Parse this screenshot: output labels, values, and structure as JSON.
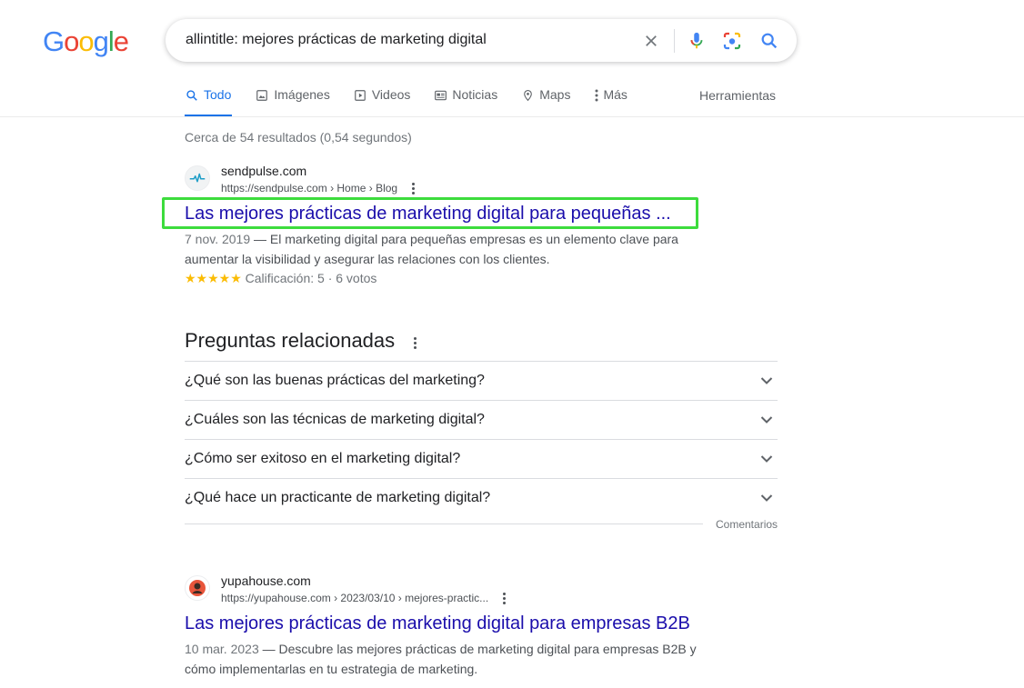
{
  "logo": {
    "letters": [
      "G",
      "o",
      "o",
      "g",
      "l",
      "e"
    ],
    "colors": [
      "#4285F4",
      "#EA4335",
      "#FBBC05",
      "#4285F4",
      "#34A853",
      "#EA4335"
    ]
  },
  "search": {
    "query": "allintitle: mejores prácticas de marketing digital",
    "icons": [
      "close-icon",
      "microphone-icon",
      "camera-lens-icon",
      "search-icon"
    ]
  },
  "tabs": [
    {
      "label": "Todo",
      "icon": "search-icon",
      "active": true
    },
    {
      "label": "Imágenes",
      "icon": "image-icon"
    },
    {
      "label": "Videos",
      "icon": "play-icon"
    },
    {
      "label": "Noticias",
      "icon": "news-icon"
    },
    {
      "label": "Maps",
      "icon": "map-pin-icon"
    },
    {
      "label": "Más",
      "icon": "vertical-dots-icon"
    }
  ],
  "tools_label": "Herramientas",
  "stats": "Cerca de 54 resultados (0,54 segundos)",
  "results": [
    {
      "site_name": "sendpulse.com",
      "url": "https://sendpulse.com › Home › Blog",
      "title": "Las mejores prácticas de marketing digital para pequeñas ...",
      "date": "7 nov. 2019",
      "snippet_line1": " — El marketing digital para pequeñas empresas es un elemento clave para",
      "snippet_line2": "aumentar la visibilidad y asegurar las relaciones con los clientes.",
      "stars": "★★★★★",
      "rating_text": "Calificación: 5 · 6 votos"
    },
    {
      "site_name": "yupahouse.com",
      "url": "https://yupahouse.com › 2023/03/10 › mejores-practic...",
      "title": "Las mejores prácticas de marketing digital para empresas B2B",
      "date": "10 mar. 2023",
      "snippet_line1": " — Descubre las mejores prácticas de marketing digital para empresas B2B y",
      "snippet_line2": "cómo implementarlas en tu estrategia de marketing."
    }
  ],
  "related": {
    "title": "Preguntas relacionadas",
    "questions": [
      "¿Qué son las buenas prácticas del marketing?",
      "¿Cuáles son las técnicas de marketing digital?",
      "¿Cómo ser exitoso en el marketing digital?",
      "¿Qué hace un practicante de marketing digital?"
    ],
    "feedback": "Comentarios"
  },
  "colors": {
    "link": "#1a0dab",
    "accent": "#1a73e8",
    "highlight": "#3ddc3d",
    "star": "#fbbc04"
  }
}
